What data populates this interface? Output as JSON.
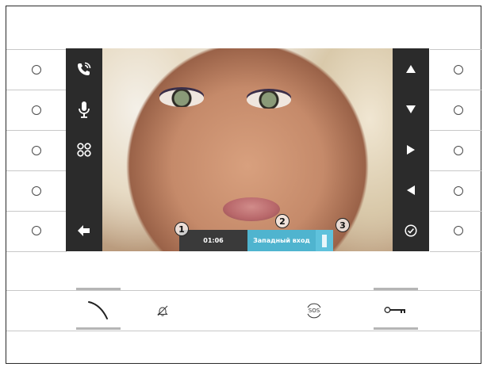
{
  "status_bar": {
    "time": "01:06",
    "door_name": "Западный вход"
  },
  "callouts": [
    "1",
    "2",
    "3"
  ],
  "bottom_bar": {
    "sos_label": "SOS"
  },
  "icons": {
    "left_toolbar": [
      "phone-call-icon",
      "microphone-icon",
      "camera-switch-icon",
      "back-arrow-icon"
    ],
    "right_toolbar": [
      "arrow-up-icon",
      "arrow-down-icon",
      "arrow-right-icon",
      "arrow-left-icon",
      "check-circle-icon"
    ],
    "bottom": [
      "handset-icon",
      "bell-off-icon",
      "sos-icon",
      "key-icon"
    ]
  },
  "colors": {
    "toolbar": "#2b2b2b",
    "door_badge": "#4fb4cf",
    "time_badge": "#3a3a3a"
  }
}
